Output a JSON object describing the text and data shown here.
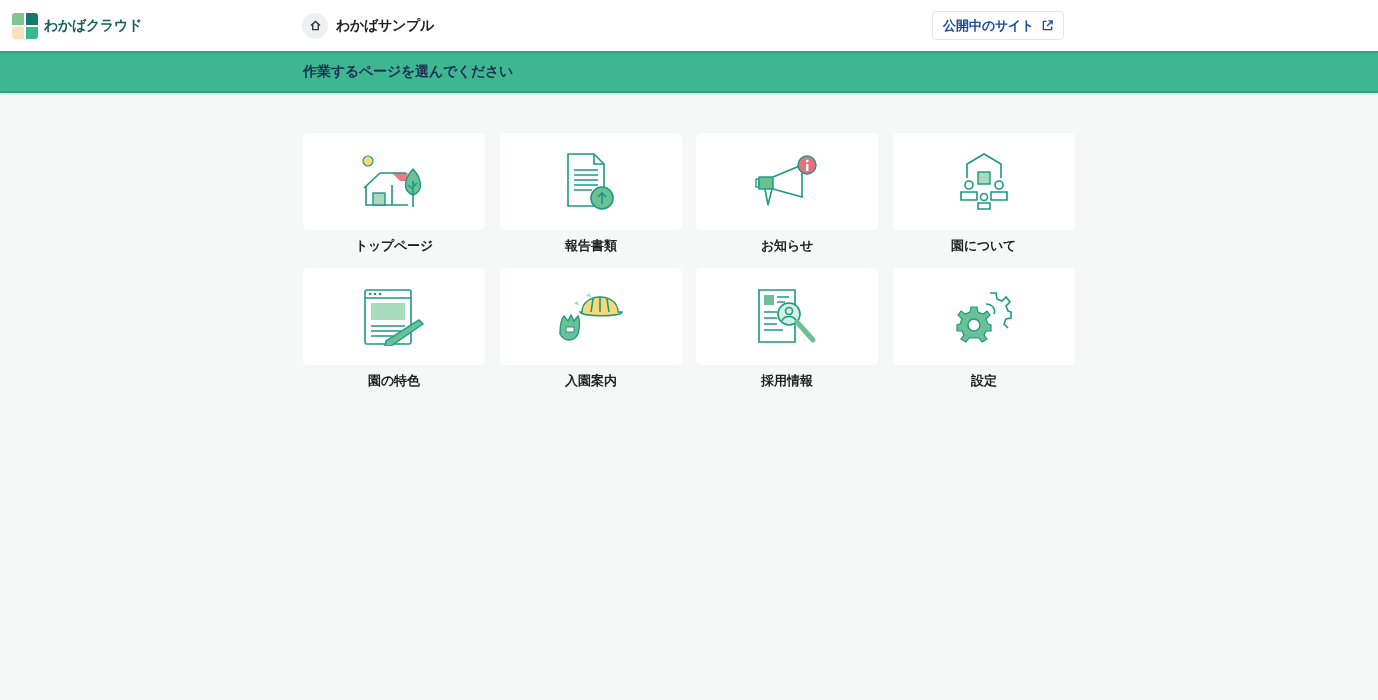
{
  "header": {
    "brand": "わかばクラウド",
    "site_name": "わかばサンプル",
    "public_site_button": "公開中のサイト"
  },
  "banner": {
    "title": "作業するページを選んでください"
  },
  "tiles": [
    {
      "kind": "home",
      "label": "トップページ"
    },
    {
      "kind": "report",
      "label": "報告書類"
    },
    {
      "kind": "news",
      "label": "お知らせ"
    },
    {
      "kind": "about",
      "label": "園について"
    },
    {
      "kind": "features",
      "label": "園の特色"
    },
    {
      "kind": "admission",
      "label": "入園案内"
    },
    {
      "kind": "recruit",
      "label": "採用情報"
    },
    {
      "kind": "settings",
      "label": "設定"
    }
  ]
}
